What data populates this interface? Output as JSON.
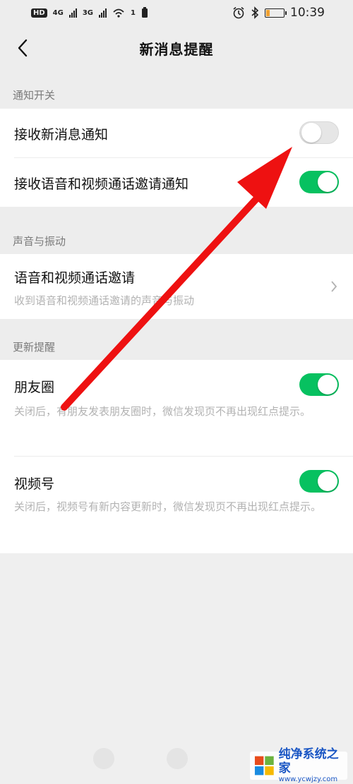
{
  "status_bar": {
    "hd_badge": "HD",
    "sim1_tag": "4G",
    "sim2_tag": "3G",
    "wifi_count": "1",
    "time": "10:39",
    "battery_percent": 20
  },
  "nav": {
    "title": "新消息提醒"
  },
  "sections": {
    "notifications": {
      "label": "通知开关",
      "receive_new": {
        "label": "接收新消息通知",
        "enabled": false
      },
      "receive_call": {
        "label": "接收语音和视频通话邀请通知",
        "enabled": true
      }
    },
    "sound": {
      "label": "声音与振动",
      "call_invite": {
        "label": "语音和视频通话邀请",
        "desc": "收到语音和视频通话邀请的声音与振动"
      }
    },
    "updates": {
      "label": "更新提醒",
      "moments": {
        "label": "朋友圈",
        "desc": "关闭后，有朋友发表朋友圈时，微信发现页不再出现红点提示。",
        "enabled": true
      },
      "channels": {
        "label": "视频号",
        "desc": "关闭后，视频号有新内容更新时，微信发现页不再出现红点提示。",
        "enabled": true
      }
    }
  },
  "annotation": {
    "arrow_color": "#ee1111"
  },
  "watermark": {
    "name": "纯净系统之家",
    "url": "www.ycwjzy.com"
  },
  "colors": {
    "toggle_on": "#07c160",
    "background": "#ededed"
  }
}
